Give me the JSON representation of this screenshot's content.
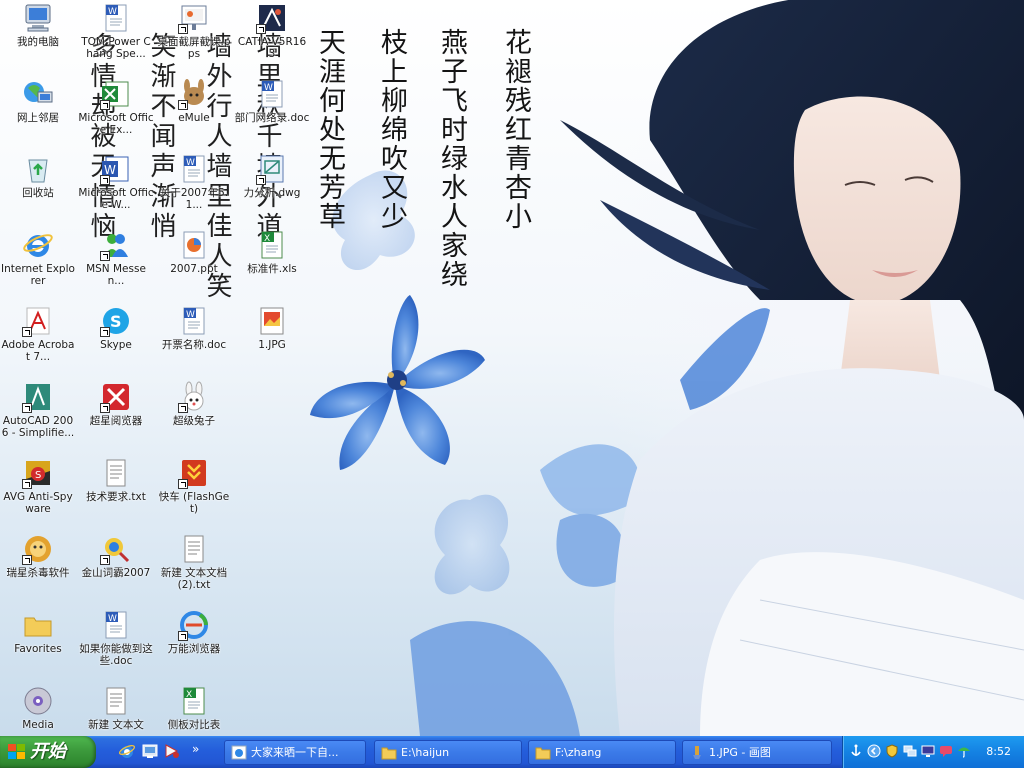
{
  "desktop": {
    "poem_columns": [
      "天涯何处无芳草",
      "枝上柳绵吹又少",
      "燕子飞时绿水人家绕",
      "花褪残红青杏小"
    ],
    "poem_ghost_left": [
      "笑渐不闻声渐悄",
      "多情却被无情恼",
      "墙外行人墙里佳人笑",
      "墙里秋千墙外道"
    ],
    "icons": [
      {
        "label": "我的电脑",
        "icon": "my-computer-icon"
      },
      {
        "label": "网上邻居",
        "icon": "network-neighborhood-icon"
      },
      {
        "label": "回收站",
        "icon": "recycle-bin-icon"
      },
      {
        "label": "Internet Explorer",
        "icon": "internet-explorer-icon"
      },
      {
        "label": "Adobe Acrobat 7...",
        "icon": "adobe-acrobat-icon"
      },
      {
        "label": "AutoCAD 2006 - Simplifie...",
        "icon": "autocad-icon"
      },
      {
        "label": "AVG Anti-Spyware",
        "icon": "avg-antispyware-icon"
      },
      {
        "label": "瑞星杀毒软件",
        "icon": "rising-antivirus-icon"
      },
      {
        "label": "Favorites",
        "icon": "folder-icon"
      },
      {
        "label": "Media",
        "icon": "media-player-icon"
      },
      {
        "label": "TOM Power Chang Spe...",
        "icon": "word-document-icon"
      },
      {
        "label": "Microsoft Office Ex...",
        "icon": "excel-icon"
      },
      {
        "label": "Microsoft Office W...",
        "icon": "word-icon"
      },
      {
        "label": "MSN Messen...",
        "icon": "msn-messenger-icon"
      },
      {
        "label": "Skype",
        "icon": "skype-icon"
      },
      {
        "label": "超星阅览器",
        "icon": "superstar-reader-icon"
      },
      {
        "label": "技术要求.txt",
        "icon": "text-file-icon"
      },
      {
        "label": "金山词霸2007",
        "icon": "kingsoft-dictionary-icon"
      },
      {
        "label": "如果你能做到这些.doc",
        "icon": "word-document-icon"
      },
      {
        "label": "新建 文本文",
        "icon": "text-file-icon"
      },
      {
        "label": "桌面截屏截课.pps",
        "icon": "powerpoint-show-icon"
      },
      {
        "label": "eMule",
        "icon": "emule-icon"
      },
      {
        "label": "关于2007年5.1...",
        "icon": "word-document-icon"
      },
      {
        "label": "2007.ppt",
        "icon": "powerpoint-icon"
      },
      {
        "label": "开票名称.doc",
        "icon": "word-document-icon"
      },
      {
        "label": "超级兔子",
        "icon": "super-rabbit-icon"
      },
      {
        "label": "快车 (FlashGet)",
        "icon": "flashget-icon"
      },
      {
        "label": "新建 文本文档 (2).txt",
        "icon": "text-file-icon"
      },
      {
        "label": "万能浏览器",
        "icon": "browser-icon"
      },
      {
        "label": "侧板对比表",
        "icon": "excel-file-icon"
      },
      {
        "label": "CATIA V5R16 3",
        "icon": "catia-icon"
      },
      {
        "label": "部门网络录.doc",
        "icon": "word-document-icon"
      },
      {
        "label": "力分析.dwg",
        "icon": "dwg-file-icon"
      },
      {
        "label": "标准件.xls",
        "icon": "excel-file-icon"
      },
      {
        "label": "1.JPG",
        "icon": "jpg-file-icon"
      }
    ]
  },
  "taskbar": {
    "start_label": "开始",
    "quick_launch": [
      "internet-explorer-icon",
      "show-desktop-icon",
      "media-icon"
    ],
    "quick_launch_more": "»",
    "tasks": [
      {
        "label": "大家来晒一下自...",
        "icon": "internet-explorer-icon"
      },
      {
        "label": "E:\\haijun",
        "icon": "folder-icon"
      },
      {
        "label": "F:\\zhang",
        "icon": "folder-icon"
      },
      {
        "label": "1.JPG - 画图",
        "icon": "paint-icon"
      }
    ],
    "tray_icons": [
      "anchor-icon",
      "chevron-left-icon",
      "shield-icon",
      "network-icon",
      "monitor-icon",
      "chat-icon",
      "umbrella-icon"
    ],
    "clock": "8:52"
  }
}
